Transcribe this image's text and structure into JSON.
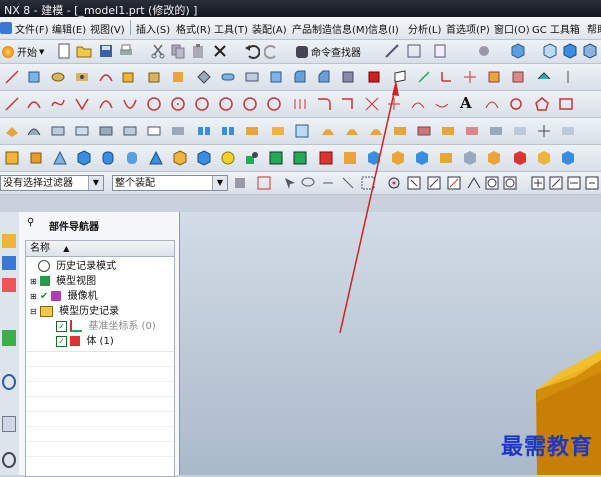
{
  "window": {
    "title": "NX 8 - 建模 - [_model1.prt  (修改的) ]"
  },
  "menu": [
    {
      "label": "文件(F)"
    },
    {
      "label": "编辑(E)"
    },
    {
      "label": "视图(V)"
    },
    {
      "label": "插入(S)"
    },
    {
      "label": "格式(R)"
    },
    {
      "label": "工具(T)"
    },
    {
      "label": "装配(A)"
    },
    {
      "label": "产品制造信息(M)"
    },
    {
      "label": "信息(I)"
    },
    {
      "label": "分析(L)"
    },
    {
      "label": "首选项(P)"
    },
    {
      "label": "窗口(O)"
    },
    {
      "label": "GC 工具箱"
    },
    {
      "label": "帮助(H)"
    }
  ],
  "standard_toolbar": {
    "start_label": "开始",
    "command_finder_label": "命令查找器"
  },
  "selection_bar": {
    "filter_value": "没有选择过滤器",
    "scope_value": "整个装配"
  },
  "navigator": {
    "title": "部件导航器",
    "column_header": "名称",
    "nodes": [
      {
        "label": "历史记录模式"
      },
      {
        "label": "模型视图"
      },
      {
        "label": "摄像机"
      },
      {
        "label": "模型历史记录"
      },
      {
        "label": "基准坐标系 (0)"
      },
      {
        "label": "体 (1)"
      }
    ]
  },
  "watermark": "最需教育",
  "colors": {
    "annotation_arrow": "#d0231f",
    "solid_body": "#e0a20c",
    "watermark": "#1d37c8"
  }
}
